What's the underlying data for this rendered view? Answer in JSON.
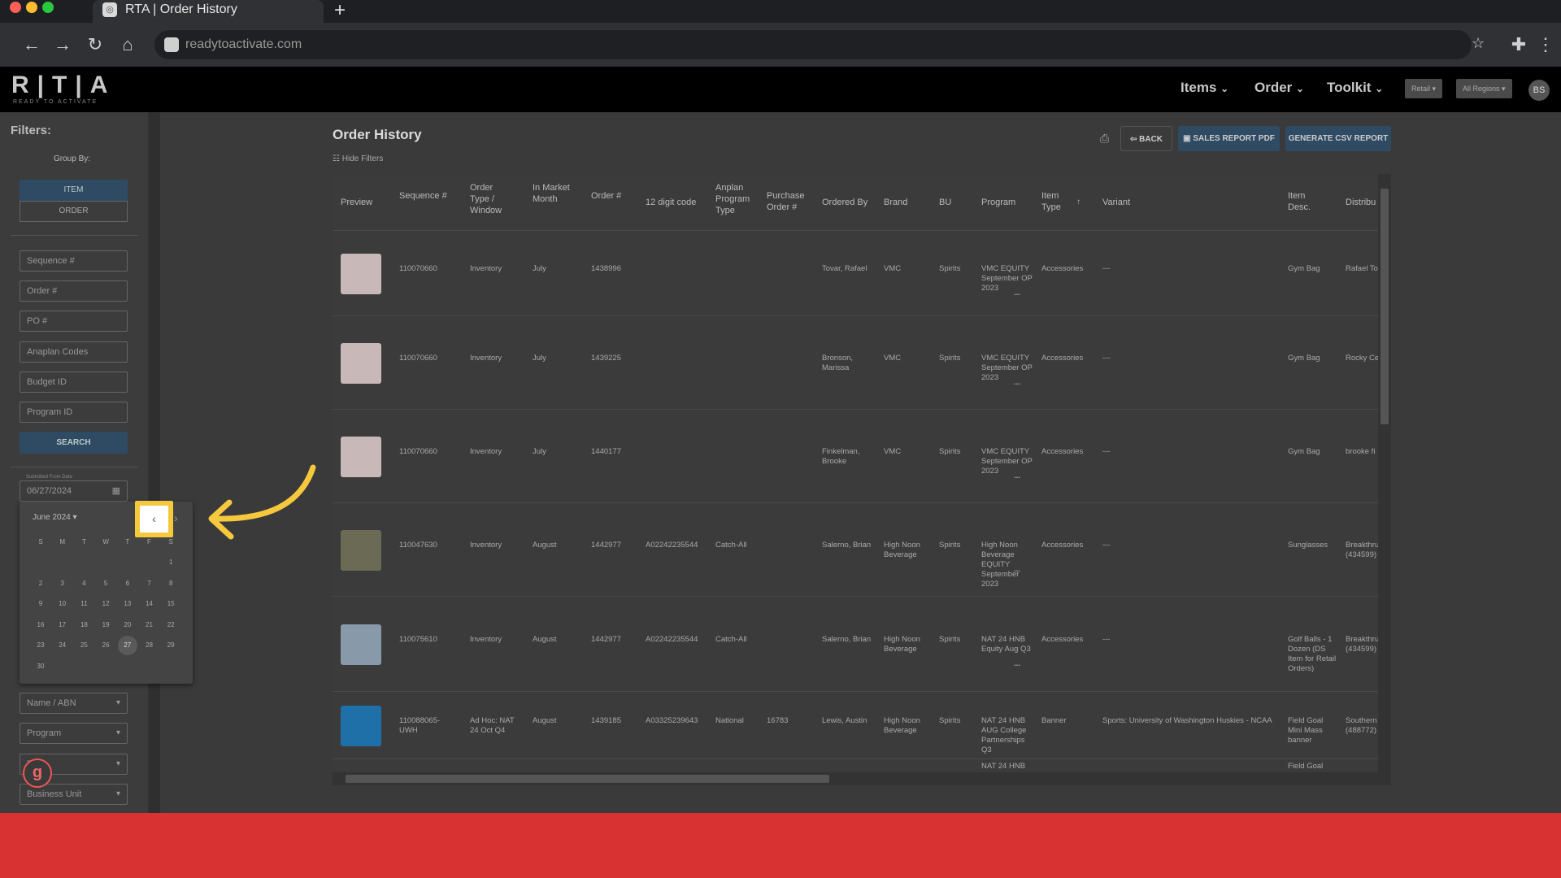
{
  "browser": {
    "tab_title": "RTA | Order History",
    "new_tab_label": "+",
    "url": "readytoactivate.com"
  },
  "app": {
    "logo": "R|T|A",
    "logo_sub": "READY TO ACTIVATE",
    "nav": [
      {
        "label": "Items",
        "icon": "chevron-down-icon"
      },
      {
        "label": "Order",
        "icon": "chevron-down-icon"
      },
      {
        "label": "Toolkit",
        "icon": "chevron-down-icon"
      }
    ],
    "channel_select": "Retail",
    "region_select": "All Regions",
    "avatar": "BS"
  },
  "sidebar": {
    "title": "Filters:",
    "group_by_label": "Group By:",
    "group_item": "ITEM",
    "group_order": "ORDER",
    "inputs": [
      "Sequence #",
      "Order #",
      "PO #",
      "Anaplan Codes",
      "Budget ID",
      "Program ID"
    ],
    "search_label": "SEARCH",
    "date_label": "Submitted From Date",
    "date_value": "06/27/2024",
    "selects": [
      "Name / ABN",
      "Program",
      "Type",
      "Business Unit"
    ]
  },
  "calendar": {
    "month_label": "June 2024",
    "weekdays": [
      "S",
      "M",
      "T",
      "W",
      "T",
      "F",
      "S"
    ],
    "days": [
      "1",
      "2",
      "3",
      "4",
      "5",
      "6",
      "7",
      "8",
      "9",
      "10",
      "11",
      "12",
      "13",
      "14",
      "15",
      "16",
      "17",
      "18",
      "19",
      "20",
      "21",
      "22",
      "23",
      "24",
      "25",
      "26",
      "27",
      "28",
      "29",
      "30"
    ],
    "selected_day": "27",
    "prev_icon": "‹",
    "next_icon": "›"
  },
  "main": {
    "title": "Order History",
    "hide_filters": "Hide Filters",
    "back_label": "BACK",
    "sales_pdf_label": "SALES REPORT PDF",
    "csv_label": "GENERATE CSV REPORT",
    "columns": [
      "Preview",
      "Sequence #",
      "Order Type / Window",
      "In Market Month",
      "Order #",
      "12 digit code",
      "Anplan Program Type",
      "Purchase Order #",
      "Ordered By",
      "Brand",
      "BU",
      "Program",
      "Item Type",
      "Variant",
      "Item Desc.",
      "Distribu"
    ],
    "rows": [
      {
        "seq": "110070660",
        "type": "Inventory",
        "month": "July",
        "order": "1438996",
        "code": "",
        "aptype": "",
        "po": "",
        "by": "Tovar, Rafael",
        "brand": "VMC",
        "bu": "Spirits",
        "program": "VMC EQUITY September OP 2023",
        "itype": "Accessories",
        "variant": "---",
        "desc": "Gym Bag",
        "dist": "Rafael To"
      },
      {
        "seq": "110070660",
        "type": "Inventory",
        "month": "July",
        "order": "1439225",
        "code": "",
        "aptype": "",
        "po": "",
        "by": "Bronson, Marissa",
        "brand": "VMC",
        "bu": "Spirits",
        "program": "VMC EQUITY September OP 2023",
        "itype": "Accessories",
        "variant": "---",
        "desc": "Gym Bag",
        "dist": "Rocky Ce"
      },
      {
        "seq": "110070660",
        "type": "Inventory",
        "month": "July",
        "order": "1440177",
        "code": "",
        "aptype": "",
        "po": "",
        "by": "Finkelman, Brooke",
        "brand": "VMC",
        "bu": "Spirits",
        "program": "VMC EQUITY September OP 2023",
        "itype": "Accessories",
        "variant": "---",
        "desc": "Gym Bag",
        "dist": "brooke fi"
      },
      {
        "seq": "110047630",
        "type": "Inventory",
        "month": "August",
        "order": "1442977",
        "code": "A02242235544",
        "aptype": "Catch-All",
        "po": "",
        "by": "Salerno, Brian",
        "brand": "High Noon Beverage",
        "bu": "Spirits",
        "program": "High Noon Beverage EQUITY September 2023",
        "itype": "Accessories",
        "variant": "---",
        "desc": "Sunglasses",
        "dist": "Breakthru (434599)"
      },
      {
        "seq": "110075610",
        "type": "Inventory",
        "month": "August",
        "order": "1442977",
        "code": "A02242235544",
        "aptype": "Catch-All",
        "po": "",
        "by": "Salerno, Brian",
        "brand": "High Noon Beverage",
        "bu": "Spirits",
        "program": "NAT 24 HNB Equity Aug Q3",
        "itype": "Accessories",
        "variant": "---",
        "desc": "Golf Balls - 1 Dozen (DS Item for Retail Orders)",
        "dist": "Breakthru (434599)"
      },
      {
        "seq": "110088065-UWH",
        "type": "Ad Hoc: NAT 24 Oct Q4",
        "month": "August",
        "order": "1439185",
        "code": "A03325239643",
        "aptype": "National",
        "po": "16783",
        "by": "Lewis, Austin",
        "brand": "High Noon Beverage",
        "bu": "Spirits",
        "program": "NAT 24 HNB AUG College Partnerships Q3",
        "itype": "Banner",
        "variant": "Sports: University of Washington Huskies - NCAA",
        "desc": "Field Goal Mini Mass banner",
        "dist": "Southern (488772)"
      },
      {
        "seq": "",
        "type": "",
        "month": "",
        "order": "",
        "code": "",
        "aptype": "",
        "po": "",
        "by": "",
        "brand": "",
        "bu": "",
        "program": "NAT 24 HNB",
        "itype": "",
        "variant": "",
        "desc": "Field Goal",
        "dist": ""
      }
    ],
    "more_glyph": "..."
  },
  "colors": {
    "accent": "#2f4a63",
    "highlight": "#f6c83e",
    "footer": "#d93232"
  }
}
